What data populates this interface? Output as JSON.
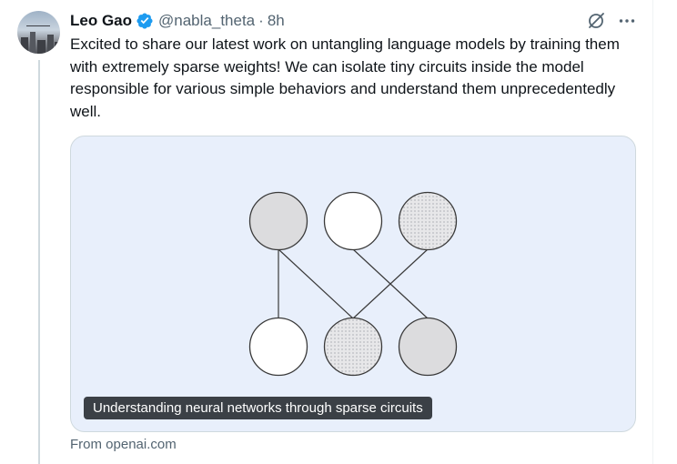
{
  "author": {
    "name": "Leo Gao",
    "handle": "@nabla_theta",
    "separator": "·",
    "time": "8h",
    "verified_icon": "verified-badge-icon",
    "accent_color": "#1d9bf0"
  },
  "actions": {
    "grok_icon": "grok-icon",
    "more_icon": "more-icon"
  },
  "tweet": {
    "text": "Excited to share our latest work on untangling language models by training them with extremely sparse weights! We can isolate tiny circuits inside the model responsible for various simple behaviors and understand them unprecedentedly well."
  },
  "card": {
    "caption": "Understanding neural networks through sparse circuits",
    "source": "From openai.com",
    "background_color": "#e8effb"
  }
}
